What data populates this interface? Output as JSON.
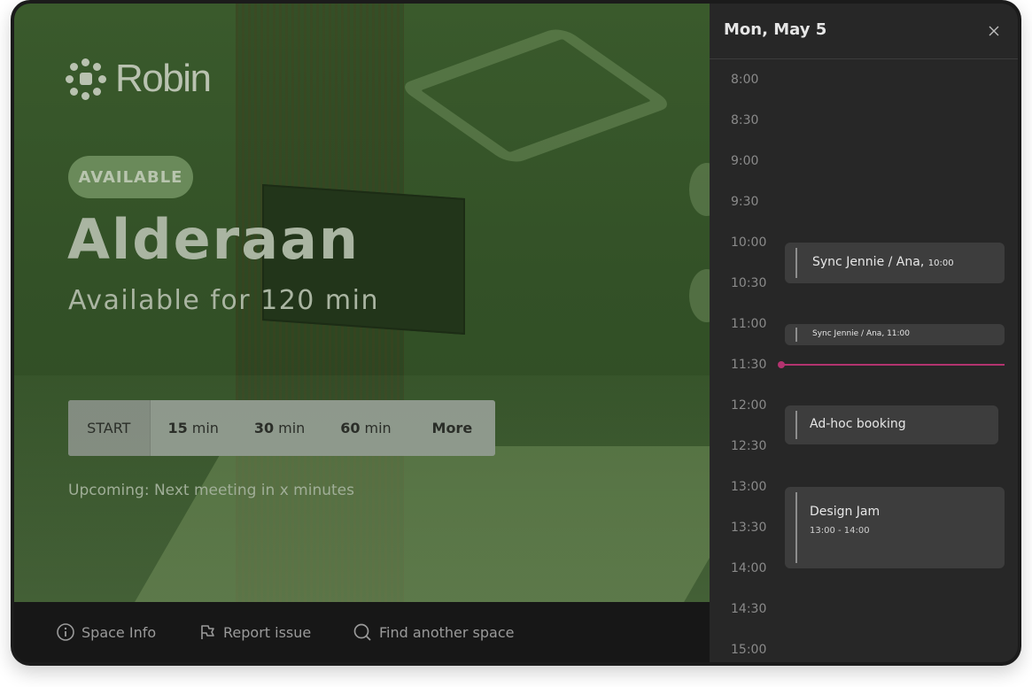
{
  "brand": {
    "name": "Robin"
  },
  "room": {
    "status": "AVAILABLE",
    "name": "Alderaan",
    "availability": "Available for 120 min",
    "upcoming": "Upcoming: Next meeting in x minutes"
  },
  "booking_buttons": {
    "start": "START",
    "options": [
      {
        "value": "15",
        "unit": "min"
      },
      {
        "value": "30",
        "unit": "min"
      },
      {
        "value": "60",
        "unit": "min"
      }
    ],
    "more": "More"
  },
  "footer": {
    "space_info": "Space Info",
    "report_issue": "Report issue",
    "find_space": "Find another space"
  },
  "schedule": {
    "date": "Mon, May 5",
    "close_icon": "close-icon",
    "times": [
      "8:00",
      "8:30",
      "9:00",
      "9:30",
      "10:00",
      "10:30",
      "11:00",
      "11:30",
      "12:00",
      "12:30",
      "13:00",
      "13:30",
      "14:00",
      "14:30",
      "15:00"
    ],
    "current_time": "11:30",
    "events": [
      {
        "title": "Sync Jennie / Ana,",
        "time": "10:00"
      },
      {
        "title": "Sync Jennie / Ana,",
        "time": "11:00"
      },
      {
        "title": "Ad-hoc booking",
        "time": ""
      },
      {
        "title": "Design Jam",
        "time": "13:00 - 14:00"
      }
    ]
  },
  "colors": {
    "now_indicator": "#b3336f",
    "panel_bg": "#272727",
    "overlay_green": "#3a5a2c"
  }
}
